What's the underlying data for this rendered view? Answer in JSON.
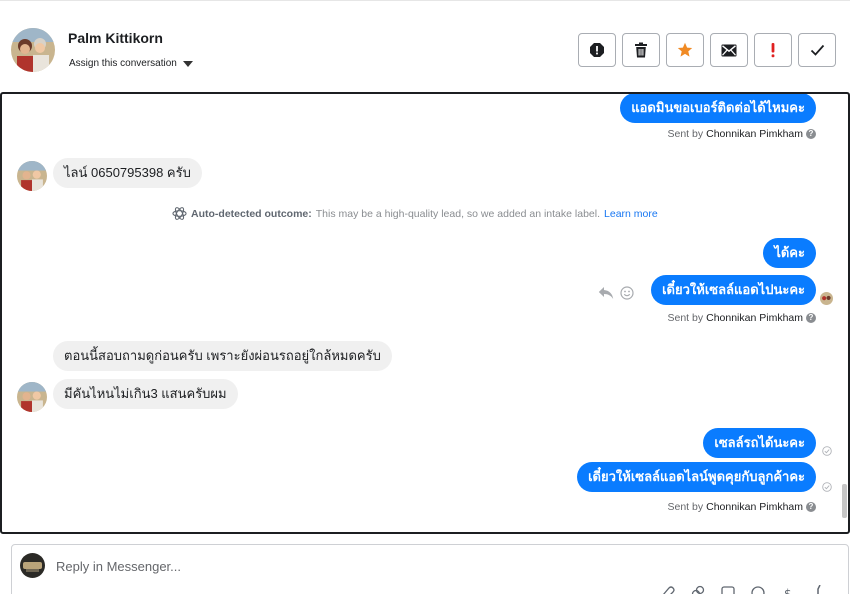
{
  "header": {
    "contact_name": "Palm Kittikorn",
    "assign_label": "Assign this conversation",
    "actions": [
      {
        "name": "spam-icon"
      },
      {
        "name": "trash-icon"
      },
      {
        "name": "star-icon"
      },
      {
        "name": "envelope-icon"
      },
      {
        "name": "exclamation-icon"
      },
      {
        "name": "check-icon"
      }
    ]
  },
  "messages": {
    "m1": "แอดมินขอเบอร์ติดต่อได้ไหมคะ",
    "m1_sent_prefix": "Sent by",
    "m1_sender": "Chonnikan Pimkham",
    "m2": "ไลน์ 0650795398 ครับ",
    "notice_title": "Auto-detected outcome:",
    "notice_body": "This may be a high-quality lead, so we added an intake label.",
    "notice_link": "Learn more",
    "m3": "ได้คะ",
    "m4": "เดี๋ยวให้เซลล์แอดไปนะคะ",
    "m4_sent_prefix": "Sent by",
    "m4_sender": "Chonnikan Pimkham",
    "m5": "ตอนนี้สอบถามดูก่อนครับ เพราะยังผ่อนรถอยู่ใกล้หมดครับ",
    "m6": "มีคันไหนไม่เกิน3 แสนครับผม",
    "m7": "เซลล์รถได้นะคะ",
    "m8": "เดี๋ยวให้เซลล์แอดไลน์พูดคุยกับลูกค้าคะ",
    "m8_sent_prefix": "Sent by",
    "m8_sender": "Chonnikan Pimkham"
  },
  "reply": {
    "placeholder": "Reply in Messenger..."
  },
  "colors": {
    "outgoing_bubble": "#0a7cff",
    "incoming_bubble": "#f0f0f0",
    "star": "#f08a24",
    "alert": "#e02020",
    "link": "#1877f2"
  }
}
